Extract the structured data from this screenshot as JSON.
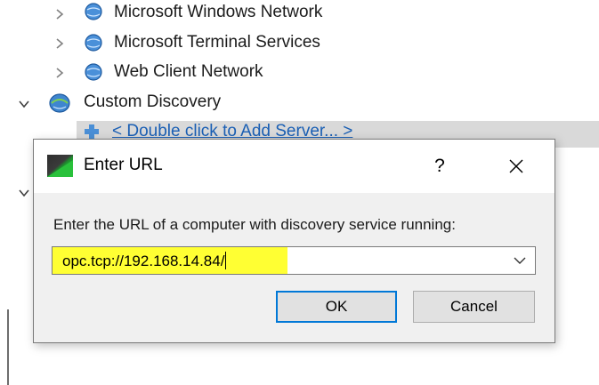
{
  "tree": {
    "items": [
      {
        "label": "Microsoft Windows Network"
      },
      {
        "label": "Microsoft Terminal Services"
      },
      {
        "label": "Web Client Network"
      },
      {
        "label": "Custom Discovery"
      }
    ],
    "add_server_label": "< Double click to Add Server... >"
  },
  "dialog": {
    "title": "Enter URL",
    "help_label": "?",
    "prompt": "Enter the URL of a computer with discovery service running:",
    "url_value": "opc.tcp://192.168.14.84/",
    "ok_label": "OK",
    "cancel_label": "Cancel"
  },
  "colors": {
    "highlight": "#ffff33",
    "link": "#1a5fb4",
    "selection": "#d9d9d9",
    "ok_border": "#0078d7"
  },
  "icons": [
    "chevron-right-icon",
    "chevron-down-icon",
    "network-globe-icon",
    "server-add-icon",
    "app-icon",
    "close-icon",
    "dropdown-arrow-icon"
  ]
}
